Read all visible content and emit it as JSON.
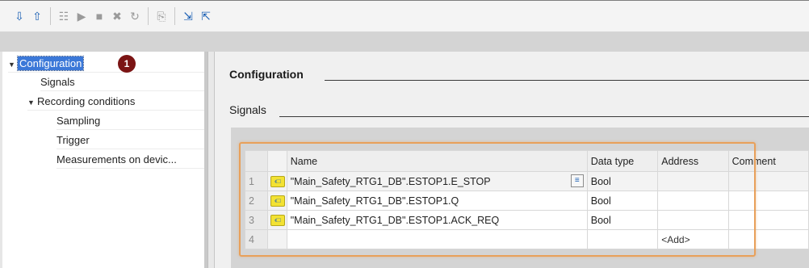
{
  "toolbar": {
    "buttons": [
      {
        "icon": "download-to-device-icon"
      },
      {
        "icon": "upload-from-device-icon"
      },
      {
        "icon": "monitor-icon"
      },
      {
        "icon": "start-recording-icon"
      },
      {
        "icon": "stop-recording-icon"
      },
      {
        "icon": "delete-recording-icon"
      },
      {
        "icon": "refresh-icon"
      },
      {
        "icon": "copy-config-icon"
      },
      {
        "icon": "export-icon"
      },
      {
        "icon": "import-icon"
      }
    ]
  },
  "tree": {
    "items": [
      {
        "label": "Configuration",
        "expanded": true,
        "selected": true
      },
      {
        "label": "Signals"
      },
      {
        "label": "Recording conditions",
        "expanded": true
      },
      {
        "label": "Sampling"
      },
      {
        "label": "Trigger"
      },
      {
        "label": "Measurements on devic..."
      }
    ],
    "badge": "1"
  },
  "main": {
    "configuration_title": "Configuration",
    "signals_title": "Signals"
  },
  "signals_table": {
    "columns": [
      "Name",
      "Data type",
      "Address",
      "Comment"
    ],
    "rows": [
      {
        "num": "1",
        "name": "\"Main_Safety_RTG1_DB\".ESTOP1.E_STOP",
        "data_type": "Bool",
        "address": "",
        "comment": ""
      },
      {
        "num": "2",
        "name": "\"Main_Safety_RTG1_DB\".ESTOP1.Q",
        "data_type": "Bool",
        "address": "",
        "comment": ""
      },
      {
        "num": "3",
        "name": "\"Main_Safety_RTG1_DB\".ESTOP1.ACK_REQ",
        "data_type": "Bool",
        "address": "",
        "comment": ""
      },
      {
        "num": "4",
        "name": "",
        "data_type": "",
        "address": "<Add>",
        "comment": ""
      }
    ]
  },
  "colors": {
    "selection": "#3b78d8",
    "badge": "#7b1414",
    "highlight": "#e8a05a",
    "signal_icon": "#f3e233"
  }
}
